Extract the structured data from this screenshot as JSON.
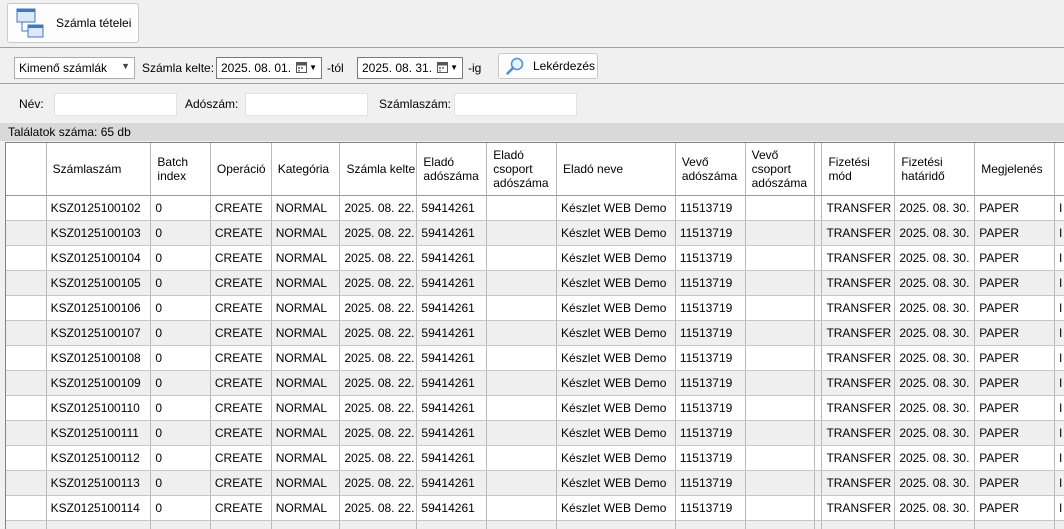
{
  "toolbar": {
    "items_button_label": "Számla tételei"
  },
  "filter": {
    "direction_selected": "Kimenő számlák",
    "date_label": "Számla kelte:",
    "date_from": "2025. 08. 01.",
    "from_suffix": "-tól",
    "date_to": "2025. 08. 31.",
    "to_suffix": "-ig",
    "query_button_label": "Lekérdezés",
    "name_label": "Név:",
    "name_value": "",
    "tax_label": "Adószám:",
    "tax_value": "",
    "invoice_no_label": "Számlaszám:",
    "invoice_no_value": ""
  },
  "status": {
    "results_text": "Találatok száma: 65 db"
  },
  "table": {
    "columns": [
      "",
      "Számlaszám",
      "Batch index",
      "Operáció",
      "Kategória",
      "Számla kelte",
      "Eladó adószáma",
      "Eladó csoport adószáma",
      "Eladó neve",
      "Vevő adószáma",
      "Vevő csoport adószáma",
      "",
      "Fizetési mód",
      "Fizetési határidő",
      "Megjelenés",
      ""
    ],
    "rows": [
      [
        "",
        "KSZ0125100102",
        "0",
        "CREATE",
        "NORMAL",
        "2025. 08. 22.",
        "59414261",
        "",
        "Készlet WEB Demo",
        "11513719",
        "",
        "",
        "TRANSFER",
        "2025. 08. 30.",
        "PAPER",
        "I"
      ],
      [
        "",
        "KSZ0125100103",
        "0",
        "CREATE",
        "NORMAL",
        "2025. 08. 22.",
        "59414261",
        "",
        "Készlet WEB Demo",
        "11513719",
        "",
        "",
        "TRANSFER",
        "2025. 08. 30.",
        "PAPER",
        "I"
      ],
      [
        "",
        "KSZ0125100104",
        "0",
        "CREATE",
        "NORMAL",
        "2025. 08. 22.",
        "59414261",
        "",
        "Készlet WEB Demo",
        "11513719",
        "",
        "",
        "TRANSFER",
        "2025. 08. 30.",
        "PAPER",
        "I"
      ],
      [
        "",
        "KSZ0125100105",
        "0",
        "CREATE",
        "NORMAL",
        "2025. 08. 22.",
        "59414261",
        "",
        "Készlet WEB Demo",
        "11513719",
        "",
        "",
        "TRANSFER",
        "2025. 08. 30.",
        "PAPER",
        "I"
      ],
      [
        "",
        "KSZ0125100106",
        "0",
        "CREATE",
        "NORMAL",
        "2025. 08. 22.",
        "59414261",
        "",
        "Készlet WEB Demo",
        "11513719",
        "",
        "",
        "TRANSFER",
        "2025. 08. 30.",
        "PAPER",
        "I"
      ],
      [
        "",
        "KSZ0125100107",
        "0",
        "CREATE",
        "NORMAL",
        "2025. 08. 22.",
        "59414261",
        "",
        "Készlet WEB Demo",
        "11513719",
        "",
        "",
        "TRANSFER",
        "2025. 08. 30.",
        "PAPER",
        "I"
      ],
      [
        "",
        "KSZ0125100108",
        "0",
        "CREATE",
        "NORMAL",
        "2025. 08. 22.",
        "59414261",
        "",
        "Készlet WEB Demo",
        "11513719",
        "",
        "",
        "TRANSFER",
        "2025. 08. 30.",
        "PAPER",
        "I"
      ],
      [
        "",
        "KSZ0125100109",
        "0",
        "CREATE",
        "NORMAL",
        "2025. 08. 22.",
        "59414261",
        "",
        "Készlet WEB Demo",
        "11513719",
        "",
        "",
        "TRANSFER",
        "2025. 08. 30.",
        "PAPER",
        "I"
      ],
      [
        "",
        "KSZ0125100110",
        "0",
        "CREATE",
        "NORMAL",
        "2025. 08. 22.",
        "59414261",
        "",
        "Készlet WEB Demo",
        "11513719",
        "",
        "",
        "TRANSFER",
        "2025. 08. 30.",
        "PAPER",
        "I"
      ],
      [
        "",
        "KSZ0125100111",
        "0",
        "CREATE",
        "NORMAL",
        "2025. 08. 22.",
        "59414261",
        "",
        "Készlet WEB Demo",
        "11513719",
        "",
        "",
        "TRANSFER",
        "2025. 08. 30.",
        "PAPER",
        "I"
      ],
      [
        "",
        "KSZ0125100112",
        "0",
        "CREATE",
        "NORMAL",
        "2025. 08. 22.",
        "59414261",
        "",
        "Készlet WEB Demo",
        "11513719",
        "",
        "",
        "TRANSFER",
        "2025. 08. 30.",
        "PAPER",
        "I"
      ],
      [
        "",
        "KSZ0125100113",
        "0",
        "CREATE",
        "NORMAL",
        "2025. 08. 22.",
        "59414261",
        "",
        "Készlet WEB Demo",
        "11513719",
        "",
        "",
        "TRANSFER",
        "2025. 08. 30.",
        "PAPER",
        "I"
      ],
      [
        "",
        "KSZ0125100114",
        "0",
        "CREATE",
        "NORMAL",
        "2025. 08. 22.",
        "59414261",
        "",
        "Készlet WEB Demo",
        "11513719",
        "",
        "",
        "TRANSFER",
        "2025. 08. 30.",
        "PAPER",
        "I"
      ],
      [
        "",
        "",
        "",
        "",
        "",
        "",
        "",
        "",
        "",
        "",
        "",
        "",
        "",
        "",
        "",
        ""
      ]
    ],
    "alt_row_color": "#efefef"
  }
}
